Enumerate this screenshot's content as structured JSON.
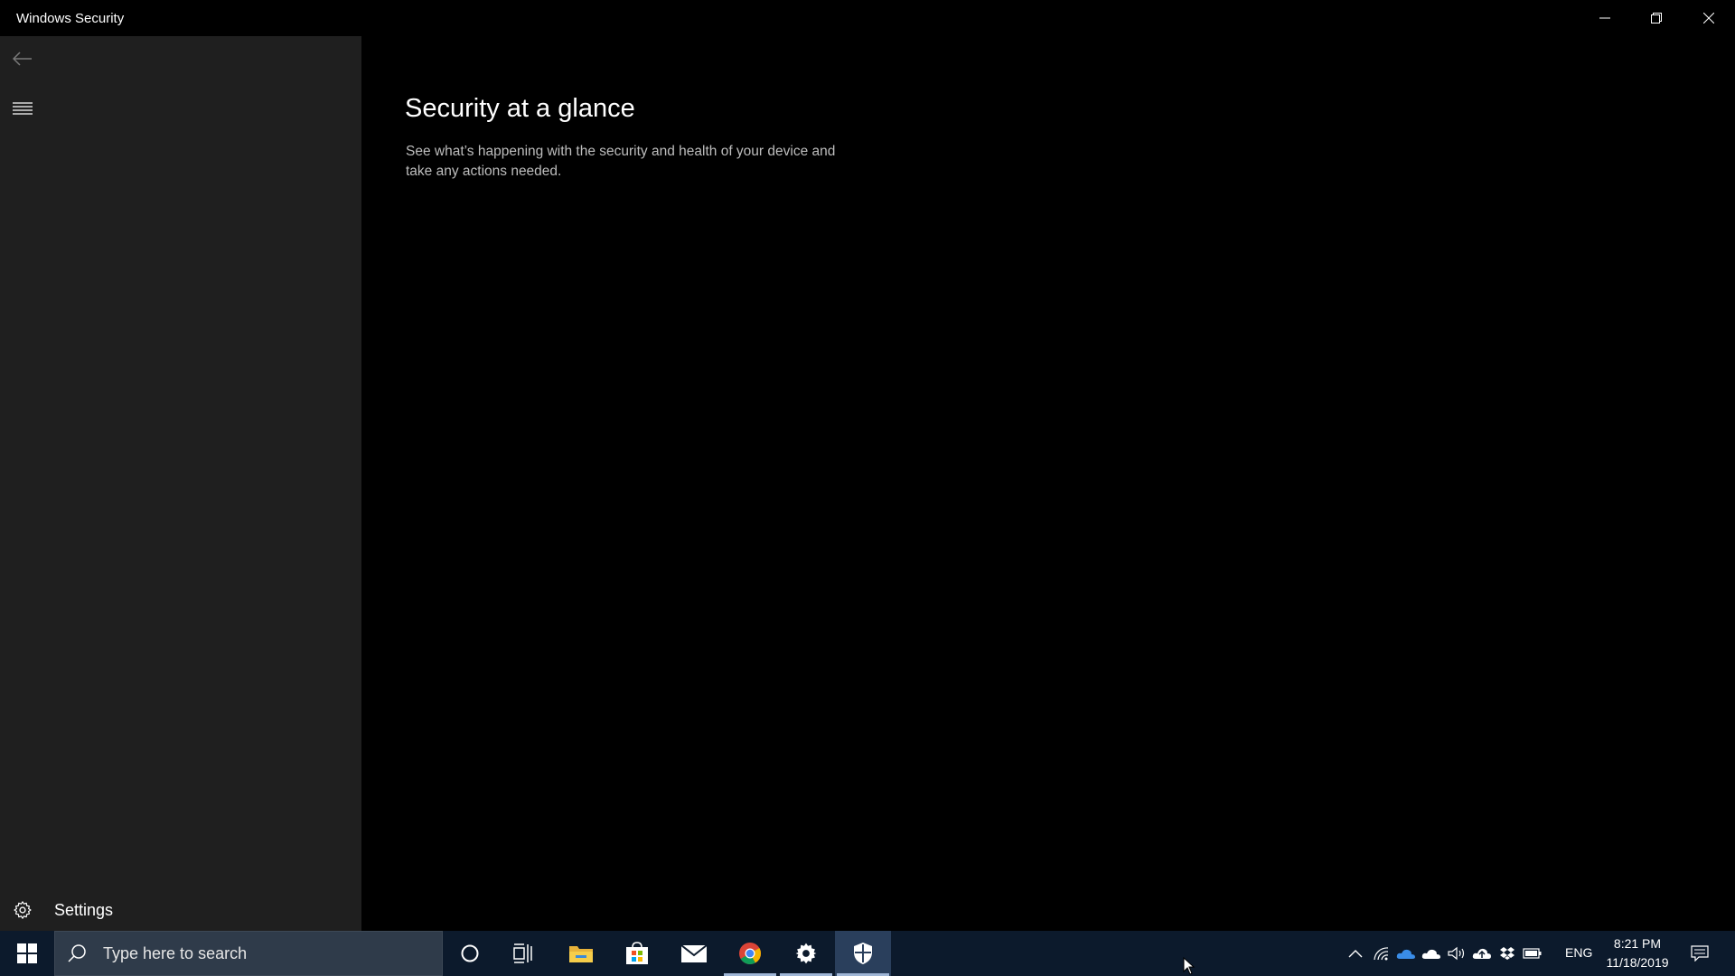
{
  "window": {
    "title": "Windows Security"
  },
  "sidebar": {
    "settings_label": "Settings"
  },
  "main": {
    "heading": "Security at a glance",
    "description": "See what’s happening with the security and health of your device and take any actions needed."
  },
  "taskbar": {
    "search_placeholder": "Type here to search",
    "pinned": [
      "cortana-icon",
      "task-view-icon",
      "file-explorer-icon",
      "microsoft-store-icon",
      "mail-icon",
      "chrome-icon",
      "settings-icon",
      "windows-security-icon"
    ],
    "tray": {
      "language": "ENG",
      "time": "8:21 PM",
      "date": "11/18/2019"
    }
  },
  "colors": {
    "sidebar_bg": "#1f1f1f",
    "main_bg": "#000000",
    "taskbar_bg": "#0c1a2c",
    "search_bg": "#2f3b4a"
  }
}
